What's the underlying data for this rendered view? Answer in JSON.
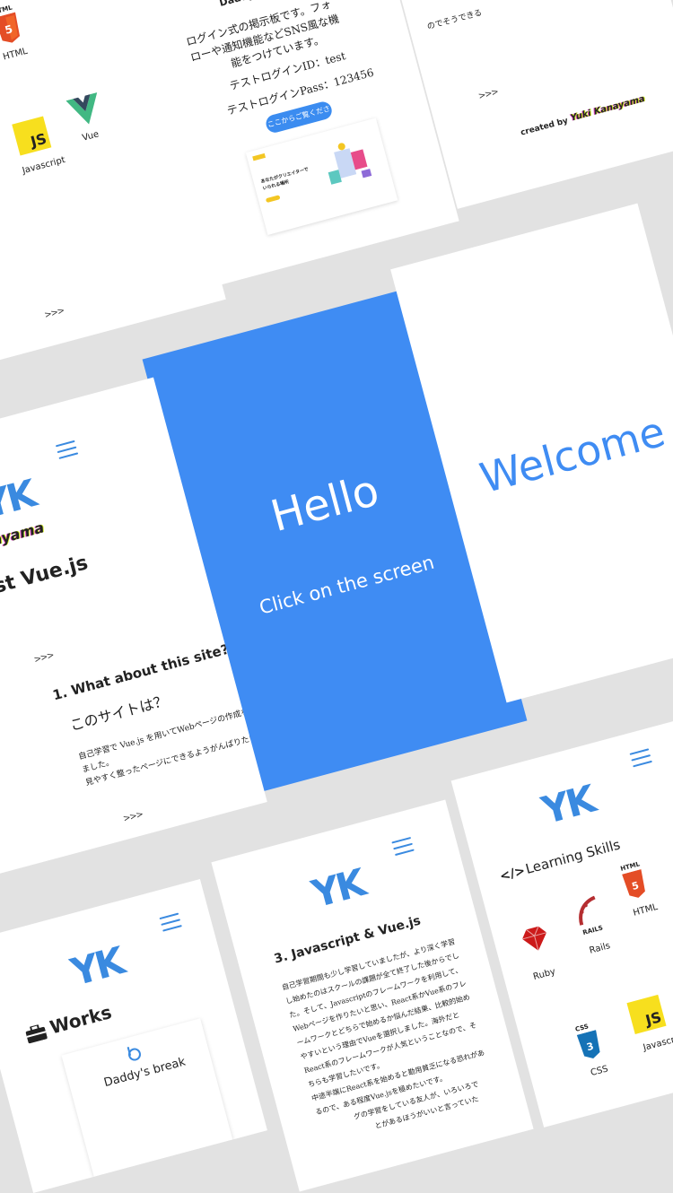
{
  "top_left_card": {
    "html_label": "HTML",
    "html_badge": "HTML",
    "js_badge": "JS",
    "js_label": "Javascript",
    "vue_label": "Vue",
    "more": ">>>"
  },
  "top_middle_card": {
    "title": "Daddy's break",
    "description_line1": "ログイン式の掲示板です。フォ",
    "description_line2": "ローや通知機能などSNS風な機",
    "description_line3": "能をつけています。",
    "test_id": "テストログインID：test",
    "test_pass": "テストログインPass：123456",
    "button_label": "ここからご覧ください",
    "preview_heading_1": "あなたがクリエイターで",
    "preview_heading_2": "いられる場所"
  },
  "top_right_card": {
    "partial_text": "のでそうできる",
    "more": ">>>",
    "created_by": "created by",
    "author": "Yuki Kanayama"
  },
  "hello_card": {
    "title": "Hello",
    "subtitle": "Click on the screen",
    "background": "#3f8cf3"
  },
  "welcome_card": {
    "title": "Welcome",
    "accent": "#3f8cf3"
  },
  "left_mid_card": {
    "logo": "YK",
    "author_partial": "Kanayama",
    "heading_partial": "irst Vue.js",
    "more_1": ">>>",
    "section_title": "1. What about this site?",
    "section_title_jp": "このサイトは？",
    "body_line1": "自己学習で Vue.js を用いてWebページの作成を実施し",
    "body_line2": "ました。",
    "body_line3": "見やすく整ったページにできるようがんばりたいです。",
    "more_2": ">>>"
  },
  "works_card": {
    "logo": "YK",
    "title": "Works",
    "item_title": "Daddy's break"
  },
  "js_vue_card": {
    "logo": "YK",
    "title": "3. Javascript & Vue.js",
    "body_line1": "自己学習期間も少し学習していましたが、より深く学習",
    "body_line2": "し始めたのはスクールの課題が全て終了した後からでし",
    "body_line3": "た。そして、Javascriptのフレームワークを利用して、",
    "body_line4": "Webページを作りたいと思い、React系かVue系のフレ",
    "body_line5": "ームワークとどちらで始めるか悩んだ結果、比較的始め",
    "body_line6": "やすいという理由でVueを選択しました。海外だと",
    "body_line7": "React系のフレームワークが人気ということなので、そ",
    "body_line8": "ちらも学習したいです。",
    "body_line9": "中途半端にReact系を始めると勘用貧乏になる恐れがあ",
    "body_line10": "るので、ある程度Vue.jsを極めたいです。",
    "body_line11": "グの学習をしている友人が、いろいろで",
    "body_line12": "とがあるほうがいいと言っていた"
  },
  "skills_card": {
    "logo": "YK",
    "title": "Learning Skills",
    "ruby_label": "Ruby",
    "rails_label": "Rails",
    "rails_badge": "RAILS",
    "html_label": "HTML",
    "html_badge": "HTML",
    "css_label": "CSS",
    "css_badge": "CSS",
    "js_label": "Javascript",
    "js_badge": "JS"
  }
}
